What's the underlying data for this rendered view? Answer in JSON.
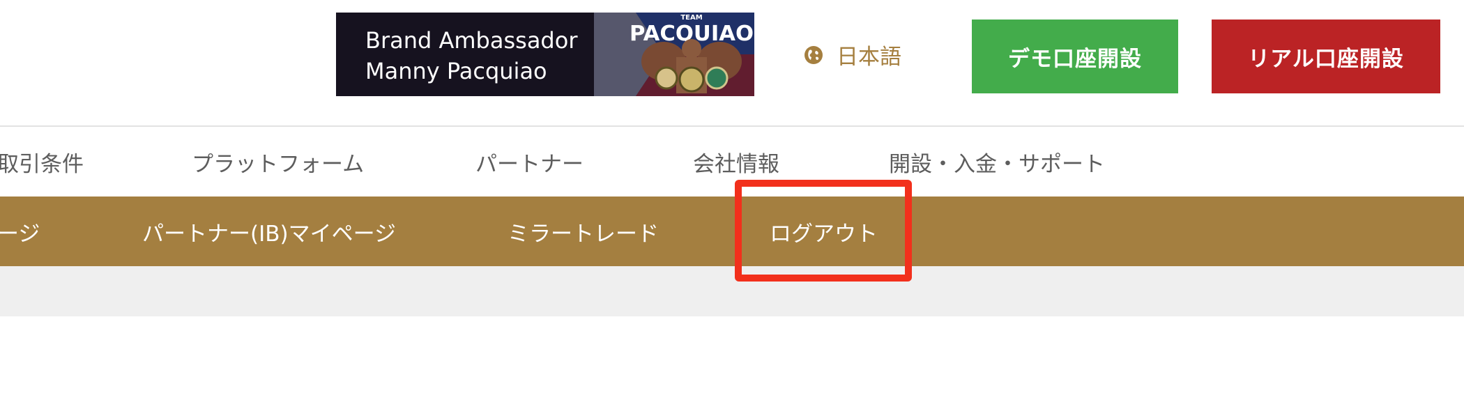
{
  "header": {
    "banner": {
      "line1": "Brand Ambassador",
      "line2": "Manny Pacquiao",
      "team_text": "TEAM",
      "name_text": "PACQUIAO"
    },
    "language": {
      "label": "日本語",
      "icon": "globe-icon"
    },
    "demo_button": {
      "label": "デモ口座開設",
      "color": "#43ac4b"
    },
    "real_button": {
      "label": "リアル口座開設",
      "color": "#bb2325"
    }
  },
  "main_nav": {
    "items": [
      {
        "label": "取引条件"
      },
      {
        "label": "プラットフォーム"
      },
      {
        "label": "パートナー"
      },
      {
        "label": "会社情報"
      },
      {
        "label": "開設・入金・サポート"
      }
    ]
  },
  "sub_nav": {
    "background": "#a47f40",
    "items": [
      {
        "label": "ージ"
      },
      {
        "label": "パートナー(IB)マイページ"
      },
      {
        "label": "ミラートレード"
      },
      {
        "label": "ログアウト",
        "highlighted": true
      }
    ]
  },
  "annotation": {
    "color": "#f2301c"
  }
}
